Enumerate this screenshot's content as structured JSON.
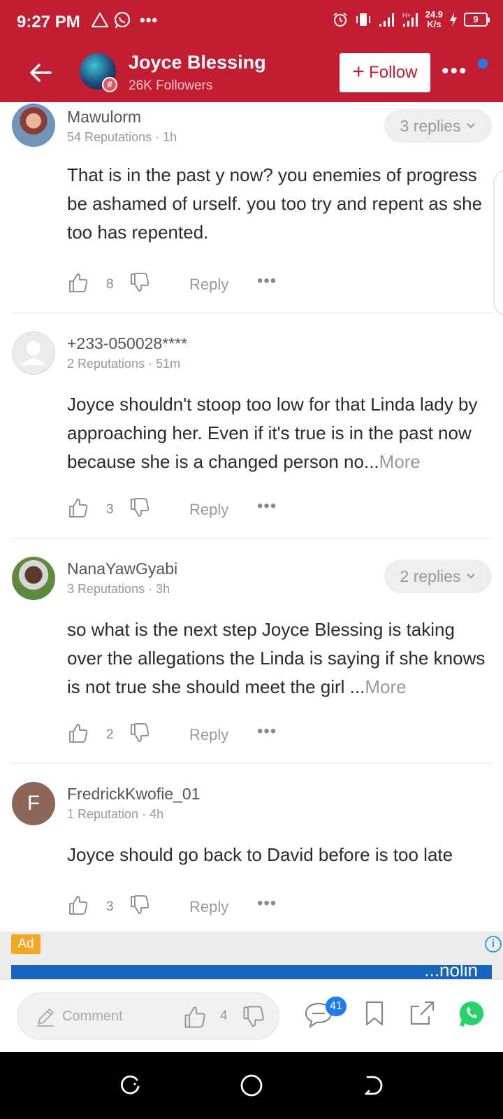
{
  "status_bar": {
    "time": "9:27 PM",
    "net_speed_value": "24.9",
    "net_speed_unit": "K/s",
    "battery": "9",
    "icons": [
      "warning-icon",
      "whatsapp-icon",
      "more-dots",
      "alarm-icon",
      "vibrate-icon",
      "signal-icon",
      "signal-icon",
      "charging-icon",
      "battery-icon"
    ]
  },
  "header": {
    "channel_name": "Joyce Blessing",
    "followers": "26K Followers",
    "follow_label": "Follow",
    "more_label": "•••",
    "badge_symbol": "#",
    "colors": {
      "bar": "#c21d30",
      "notification_dot": "#1f7cf0"
    }
  },
  "comments": [
    {
      "user": "Mawulorm",
      "meta": "54 Reputations · 1h",
      "replies": "3 replies",
      "text": "That is in the past y now? you enemies of progress be ashamed of urself. you too try and repent as she too has repented.",
      "more": "",
      "likes": "8",
      "reply_label": "Reply",
      "more_label": "•••"
    },
    {
      "user": "+233-050028****",
      "meta": "2 Reputations · 51m",
      "replies": "",
      "text": "Joyce shouldn't stoop too low for that Linda lady by approaching her. Even if it's true is in the past now because she is a changed person no...",
      "more": "More",
      "likes": "3",
      "reply_label": "Reply",
      "more_label": "•••"
    },
    {
      "user": "NanaYawGyabi",
      "meta": "3 Reputations · 3h",
      "replies": "2 replies",
      "text": "so what is the next step Joyce Blessing is taking over the allegations the Linda is saying if she knows is not true she should meet the girl ...",
      "more": "More",
      "likes": "2",
      "reply_label": "Reply",
      "more_label": "•••"
    },
    {
      "user": "FredrickKwofie_01",
      "avatar_letter": "F",
      "meta": "1 Reputation · 4h",
      "replies": "",
      "text": "Joyce should go back to David  before is too late",
      "more": "",
      "likes": "3",
      "reply_label": "Reply",
      "more_label": "•••"
    }
  ],
  "ad": {
    "badge": "Ad",
    "info": "i",
    "banner_text": "...nolin"
  },
  "bottom_bar": {
    "comment_placeholder": "Comment",
    "likes": "4",
    "comments_badge": "41"
  },
  "nav_bar": {
    "buttons": [
      "recents-button",
      "home-button",
      "back-button"
    ]
  }
}
